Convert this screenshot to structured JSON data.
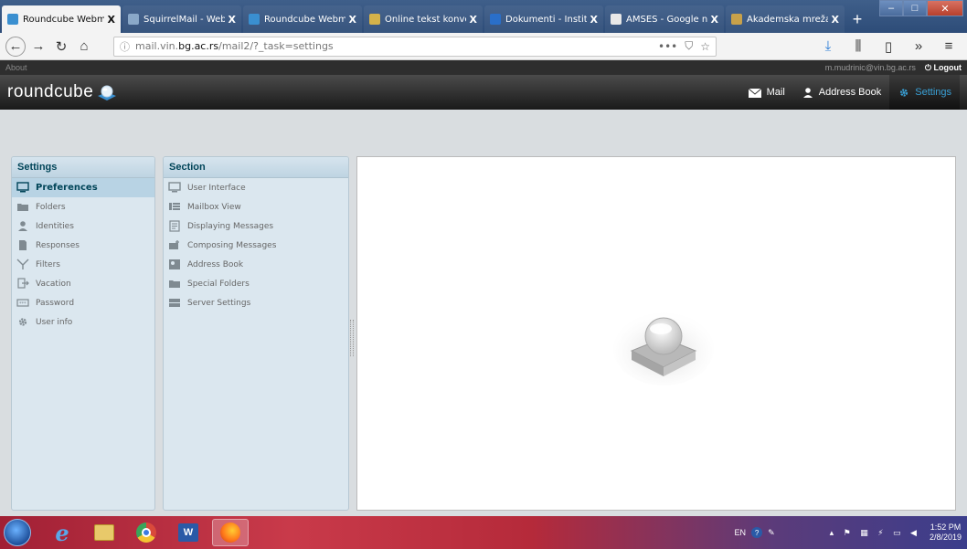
{
  "browser": {
    "tabs": [
      {
        "label": "Roundcube Webma",
        "favicon": "roundcube-favicon",
        "color": "#3a8fd0",
        "active": true
      },
      {
        "label": "SquirrelMail - Webr",
        "favicon": "squirrelmail-favicon",
        "color": "#8aa8c8",
        "active": false
      },
      {
        "label": "Roundcube Webma",
        "favicon": "roundcube-favicon",
        "color": "#3a8fd0",
        "active": false
      },
      {
        "label": "Online tekst konvert",
        "favicon": "converter-favicon",
        "color": "#d4b24a",
        "active": false
      },
      {
        "label": "Dokumenti - Institut",
        "favicon": "documents-favicon",
        "color": "#2a6fc9",
        "active": false
      },
      {
        "label": "AMSES - Google np",
        "favicon": "google-favicon",
        "color": "#e8e8e8",
        "active": false
      },
      {
        "label": "Akademska mreža R",
        "favicon": "amres-favicon",
        "color": "#c8a14a",
        "active": false
      }
    ],
    "tab_close": "X",
    "new_tab": "+",
    "url_pre": "mail.vin.",
    "url_domain": "bg.ac.rs",
    "url_post": "/mail2/?_task=settings",
    "url_more": "•••"
  },
  "topline": {
    "about": "About",
    "user": "m.mudrinic@vin.bg.ac.rs",
    "logout": "Logout"
  },
  "header": {
    "logo_text": "roundcube",
    "nav": [
      {
        "label": "Mail",
        "icon": "envelope-icon",
        "selected": false
      },
      {
        "label": "Address Book",
        "icon": "person-icon",
        "selected": false
      },
      {
        "label": "Settings",
        "icon": "gear-icon",
        "selected": true
      }
    ]
  },
  "settings_panel": {
    "title": "Settings",
    "items": [
      {
        "label": "Preferences",
        "icon": "monitor-icon",
        "selected": true
      },
      {
        "label": "Folders",
        "icon": "folder-icon",
        "selected": false
      },
      {
        "label": "Identities",
        "icon": "person-icon",
        "selected": false
      },
      {
        "label": "Responses",
        "icon": "document-icon",
        "selected": false
      },
      {
        "label": "Filters",
        "icon": "filter-icon",
        "selected": false
      },
      {
        "label": "Vacation",
        "icon": "exit-icon",
        "selected": false
      },
      {
        "label": "Password",
        "icon": "password-icon",
        "selected": false
      },
      {
        "label": "User info",
        "icon": "gear-icon",
        "selected": false
      }
    ]
  },
  "section_panel": {
    "title": "Section",
    "items": [
      {
        "label": "User Interface",
        "icon": "monitor-icon"
      },
      {
        "label": "Mailbox View",
        "icon": "list-icon"
      },
      {
        "label": "Displaying Messages",
        "icon": "message-icon"
      },
      {
        "label": "Composing Messages",
        "icon": "compose-icon"
      },
      {
        "label": "Address Book",
        "icon": "contact-card-icon"
      },
      {
        "label": "Special Folders",
        "icon": "folder-icon"
      },
      {
        "label": "Server Settings",
        "icon": "server-icon"
      }
    ]
  },
  "taskbar": {
    "lang": "EN",
    "time": "1:52 PM",
    "date": "2/8/2019"
  },
  "colors": {
    "accent": "#39a0d6",
    "panel_bg": "#dbe7ef",
    "panel_header": "#004458",
    "selected_row": "#b8d3e4"
  }
}
